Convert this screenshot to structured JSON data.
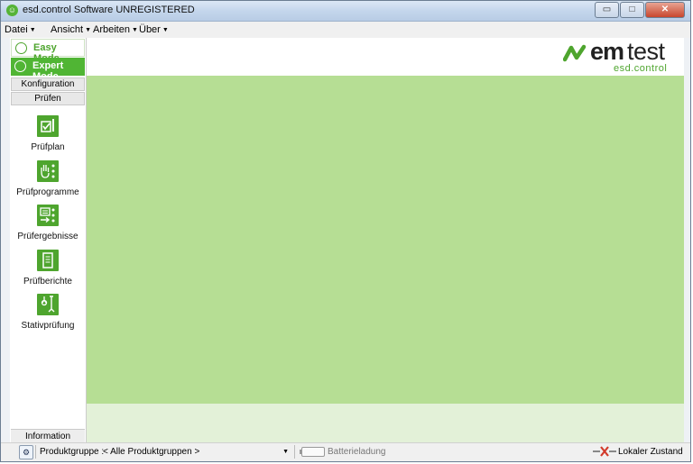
{
  "window": {
    "title": "esd.control Software UNREGISTERED",
    "min_glyph": "▭",
    "max_glyph": "□",
    "close_glyph": "✕"
  },
  "menu": [
    {
      "label": "Datei"
    },
    {
      "label": "Ansicht"
    },
    {
      "label": "Arbeiten"
    },
    {
      "label": "Über"
    }
  ],
  "modes": {
    "easy": "Easy Mode",
    "expert": "Expert Mode"
  },
  "sidebar": {
    "tabs": [
      "Konfiguration",
      "Prüfen"
    ],
    "items": [
      {
        "label": "Prüfplan",
        "icon": "checklist-icon"
      },
      {
        "label": "Prüfprogramme",
        "icon": "hand-dots-icon"
      },
      {
        "label": "Prüfergebnisse",
        "icon": "list-arrow-icon"
      },
      {
        "label": "Prüfberichte",
        "icon": "report-icon"
      },
      {
        "label": "Stativprüfung",
        "icon": "stand-probe-icon"
      }
    ],
    "info_tab": "Information"
  },
  "logo": {
    "brand_bold": "em",
    "brand_light": "test",
    "sub": "esd.control"
  },
  "status": {
    "product_group_label": "Produktgruppe :",
    "product_group_value": "< Alle Produktgruppen >",
    "battery_label": "Batterieladung",
    "connection_label": "Lokaler Zustand"
  },
  "colors": {
    "accent": "#4ea52e",
    "main_bg": "#b6de94",
    "main_lower_bg": "#e3f1d8"
  }
}
